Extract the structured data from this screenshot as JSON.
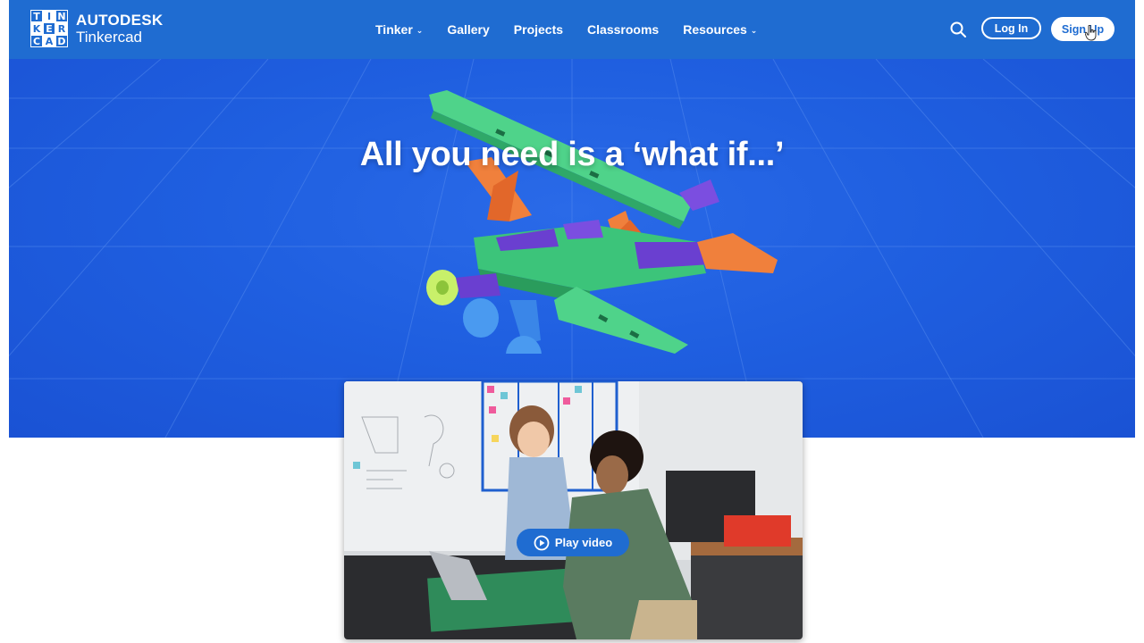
{
  "colors": {
    "header_bg": "#1f6cd1",
    "hero_bg": "#1f5fe0",
    "accent": "#1f6cd1",
    "white": "#ffffff"
  },
  "logo": {
    "grid_letters": [
      "T",
      "I",
      "N",
      "K",
      "E",
      "R",
      "C",
      "A",
      "D"
    ],
    "brand": "AUTODESK",
    "product": "Tinkercad"
  },
  "nav": {
    "items": [
      {
        "label": "Tinker",
        "has_dropdown": true
      },
      {
        "label": "Gallery",
        "has_dropdown": false
      },
      {
        "label": "Projects",
        "has_dropdown": false
      },
      {
        "label": "Classrooms",
        "has_dropdown": false
      },
      {
        "label": "Resources",
        "has_dropdown": true
      }
    ]
  },
  "header_actions": {
    "search_icon": "search-icon",
    "login_label": "Log In",
    "signup_label": "Sign Up"
  },
  "hero": {
    "title": "All you need is a ‘what if...’"
  },
  "video": {
    "play_label": "Play video",
    "play_icon": "play-circle-icon"
  }
}
